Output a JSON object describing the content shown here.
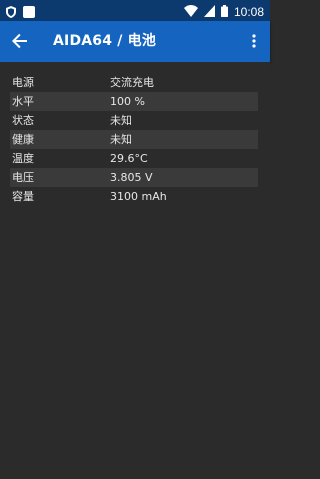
{
  "status_bar": {
    "time": "10:08",
    "left_icons": [
      "shield-icon",
      "notification-icon"
    ],
    "right_icons": [
      "wifi-icon",
      "signal-icon",
      "battery-icon"
    ]
  },
  "app_bar": {
    "title": "AIDA64  /  电池",
    "back_icon": "arrow-back-icon",
    "menu_icon": "more-vert-icon",
    "background": "#1565c0",
    "status_color": "#0c3a6e"
  },
  "battery": {
    "rows": [
      {
        "label": "电源",
        "value": "交流充电"
      },
      {
        "label": "水平",
        "value": "100 %"
      },
      {
        "label": "状态",
        "value": "未知"
      },
      {
        "label": "健康",
        "value": "未知"
      },
      {
        "label": "温度",
        "value": "29.6°C"
      },
      {
        "label": "电压",
        "value": "3.805 V"
      },
      {
        "label": "容量",
        "value": "3100 mAh"
      }
    ]
  }
}
